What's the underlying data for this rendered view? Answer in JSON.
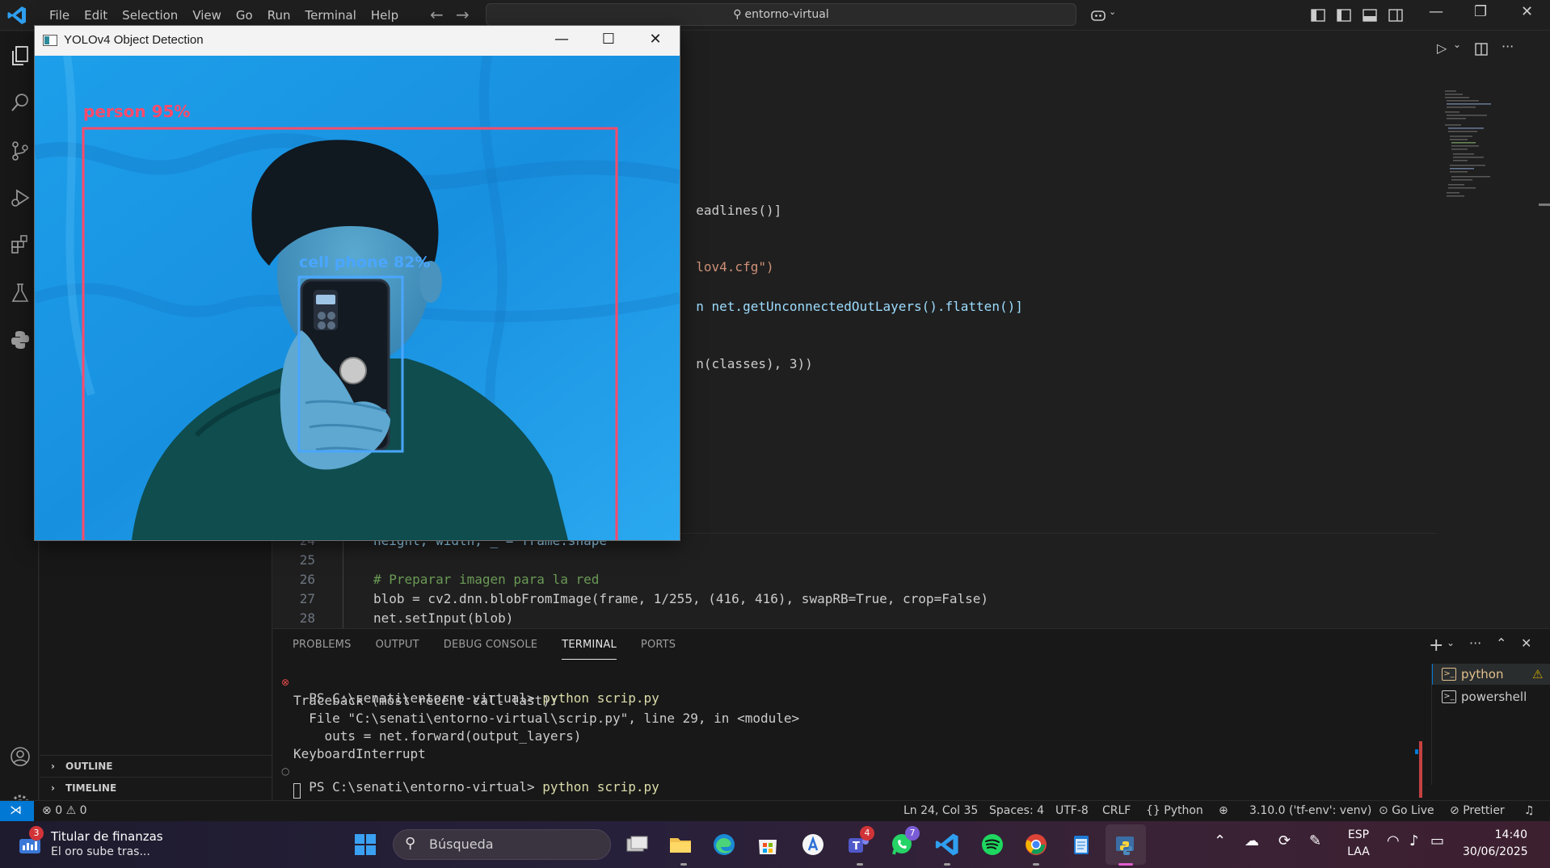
{
  "colors": {
    "accent": "#0078d4",
    "person_box": "#ff4a6b",
    "phone_box": "#4aa6ff",
    "backdrop": "#1a9ce8"
  },
  "menu": [
    "File",
    "Edit",
    "Selection",
    "View",
    "Go",
    "Run",
    "Terminal",
    "Help"
  ],
  "command_center": {
    "text": "entorno-virtual"
  },
  "sidebar": {
    "outline_label": "OUTLINE",
    "timeline_label": "TIMELINE"
  },
  "editor": {
    "visible_fragments": [
      {
        "text": "eadlines()]"
      },
      {
        "text": "lov4.cfg\")"
      },
      {
        "text": "n net.getUnconnectedOutLayers().flatten()]"
      },
      {
        "text": "n(classes), 3))"
      }
    ],
    "lines": [
      {
        "num": "24",
        "text": "height, width, _ = frame.shape"
      },
      {
        "num": "25",
        "text": ""
      },
      {
        "num": "26",
        "text": "# Preparar imagen para la red"
      },
      {
        "num": "27",
        "text": "blob = cv2.dnn.blobFromImage(frame, 1/255, (416, 416), swapRB=True, crop=False)"
      },
      {
        "num": "28",
        "text": "net.setInput(blob)"
      }
    ]
  },
  "panel": {
    "tabs": [
      "PROBLEMS",
      "OUTPUT",
      "DEBUG CONSOLE",
      "TERMINAL",
      "PORTS"
    ],
    "active_tab": "TERMINAL",
    "terminal": {
      "prompt": "PS C:\\senati\\entorno-virtual>",
      "command": "python scrip.py",
      "output": [
        "Traceback (most recent call last):",
        "  File \"C:\\senati\\entorno-virtual\\scrip.py\", line 29, in <module>",
        "    outs = net.forward(output_layers)",
        "KeyboardInterrupt"
      ]
    },
    "terminals": [
      "python",
      "powershell"
    ]
  },
  "statusbar": {
    "errors": "0",
    "warnings": "0",
    "cursor": "Ln 24, Col 35",
    "spaces": "Spaces: 4",
    "encoding": "UTF-8",
    "eol": "CRLF",
    "language": "Python",
    "interpreter": "3.10.0 ('tf-env': venv)",
    "golive": "Go Live",
    "prettier": "Prettier"
  },
  "yolo_window": {
    "title": "YOLOv4 Object Detection",
    "detections": [
      {
        "label": "person 95%"
      },
      {
        "label": "cell phone 82%"
      }
    ]
  },
  "taskbar": {
    "news_title": "Titular de finanzas",
    "news_sub": "El oro sube tras...",
    "news_badge": "3",
    "search_placeholder": "Búsqueda",
    "teams_badge": "4",
    "whatsapp_badge": "7",
    "lang": "ESP",
    "layout": "LAA",
    "time": "14:40",
    "date": "30/06/2025"
  }
}
